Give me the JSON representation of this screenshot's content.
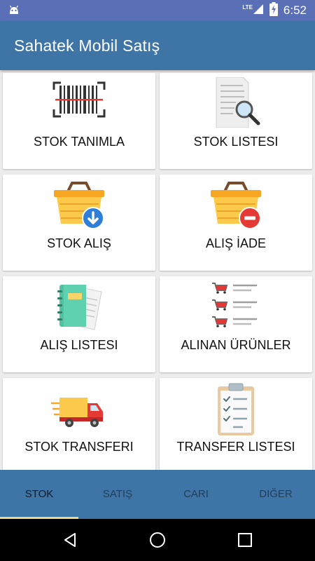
{
  "status_bar": {
    "network": "LTE",
    "time": "6:52"
  },
  "app_bar": {
    "title": "Sahatek Mobil Satış"
  },
  "tiles": [
    {
      "label": "STOK TANIMLA",
      "icon": "barcode-scan-icon"
    },
    {
      "label": "STOK LISTESI",
      "icon": "document-search-icon"
    },
    {
      "label": "STOK ALIŞ",
      "icon": "basket-download-icon"
    },
    {
      "label": "ALIŞ İADE",
      "icon": "basket-remove-icon"
    },
    {
      "label": "ALIŞ LISTESI",
      "icon": "notebook-icon"
    },
    {
      "label": "ALINAN ÜRÜNLER",
      "icon": "cart-list-icon"
    },
    {
      "label": "STOK TRANSFERI",
      "icon": "delivery-truck-icon"
    },
    {
      "label": "TRANSFER LISTESI",
      "icon": "clipboard-checklist-icon"
    }
  ],
  "tabs": [
    {
      "label": "STOK",
      "active": true
    },
    {
      "label": "SATIŞ",
      "active": false
    },
    {
      "label": "CARI",
      "active": false
    },
    {
      "label": "DIĞER",
      "active": false
    }
  ],
  "colors": {
    "status_bar": "#5a6fb6",
    "app_bar": "#3f75a6",
    "tab_indicator": "#e8d68a",
    "active_tab_text": "#0d1b2a"
  }
}
